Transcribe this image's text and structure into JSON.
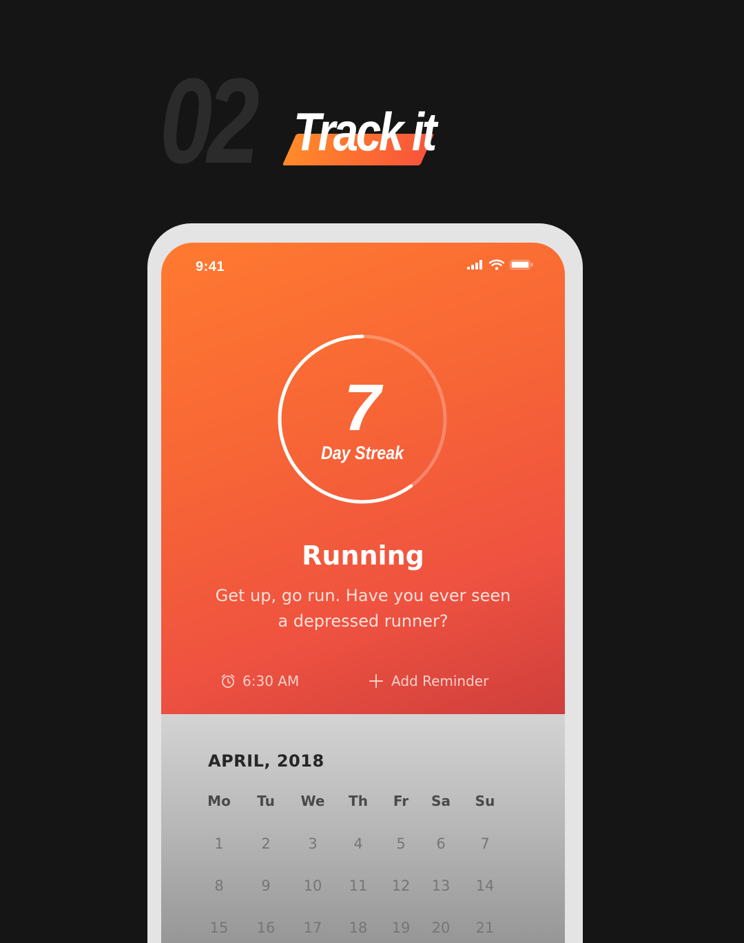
{
  "header": {
    "step_number": "02",
    "title": "Track it"
  },
  "status_bar": {
    "time": "9:41",
    "icons": [
      "signal-icon",
      "wifi-icon",
      "battery-icon"
    ]
  },
  "streak": {
    "count": "7",
    "label": "Day Streak",
    "progress": 0.6
  },
  "habit": {
    "title": "Running",
    "description": "Get up, go run. Have you ever seen a depressed runner?"
  },
  "reminder": {
    "time": "6:30 AM",
    "add_label": "Add Reminder"
  },
  "calendar": {
    "month": "APRIL, 2018",
    "weekdays": [
      "Mo",
      "Tu",
      "We",
      "Th",
      "Fr",
      "Sa",
      "Su"
    ],
    "weeks": [
      [
        "1",
        "2",
        "3",
        "4",
        "5",
        "6",
        "7"
      ],
      [
        "8",
        "9",
        "10",
        "11",
        "12",
        "13",
        "14"
      ],
      [
        "15",
        "16",
        "17",
        "18",
        "19",
        "20",
        "21"
      ]
    ]
  },
  "colors": {
    "accent_start": "#ff7a30",
    "accent_end": "#cf3f3c",
    "background": "#151515"
  }
}
